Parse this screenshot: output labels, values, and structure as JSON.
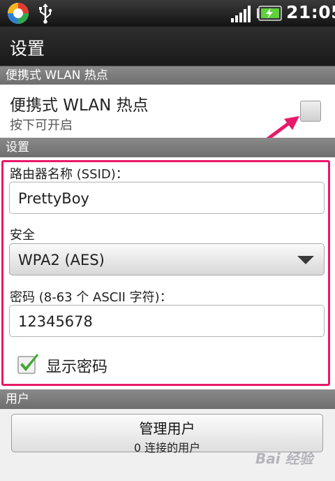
{
  "status_bar": {
    "time": "21:05",
    "icons": [
      "app-logo-icon",
      "usb-icon",
      "signal-icon",
      "battery-charging-icon"
    ]
  },
  "title_bar": {
    "title": "设置"
  },
  "hotspot_section": {
    "header": "便携式 WLAN 热点",
    "item_title": "便携式 WLAN 热点",
    "item_subtitle": "按下可开启",
    "checked": false
  },
  "settings_section": {
    "header": "设置",
    "ssid_label": "路由器名称 (SSID)：",
    "ssid_value": "PrettyBoy",
    "security_label": "安全",
    "security_value": "WPA2 (AES)",
    "password_label": "密码 (8-63 个 ASCII 字符)：",
    "password_value": "12345678",
    "show_password_label": "显示密码",
    "show_password_checked": true
  },
  "users_section": {
    "header": "用户",
    "button_title": "管理用户",
    "button_subtitle": "0 连接的用户"
  },
  "colors": {
    "highlight": "#e8196a",
    "check_green": "#3fa82f",
    "battery_green": "#5fd13a"
  }
}
